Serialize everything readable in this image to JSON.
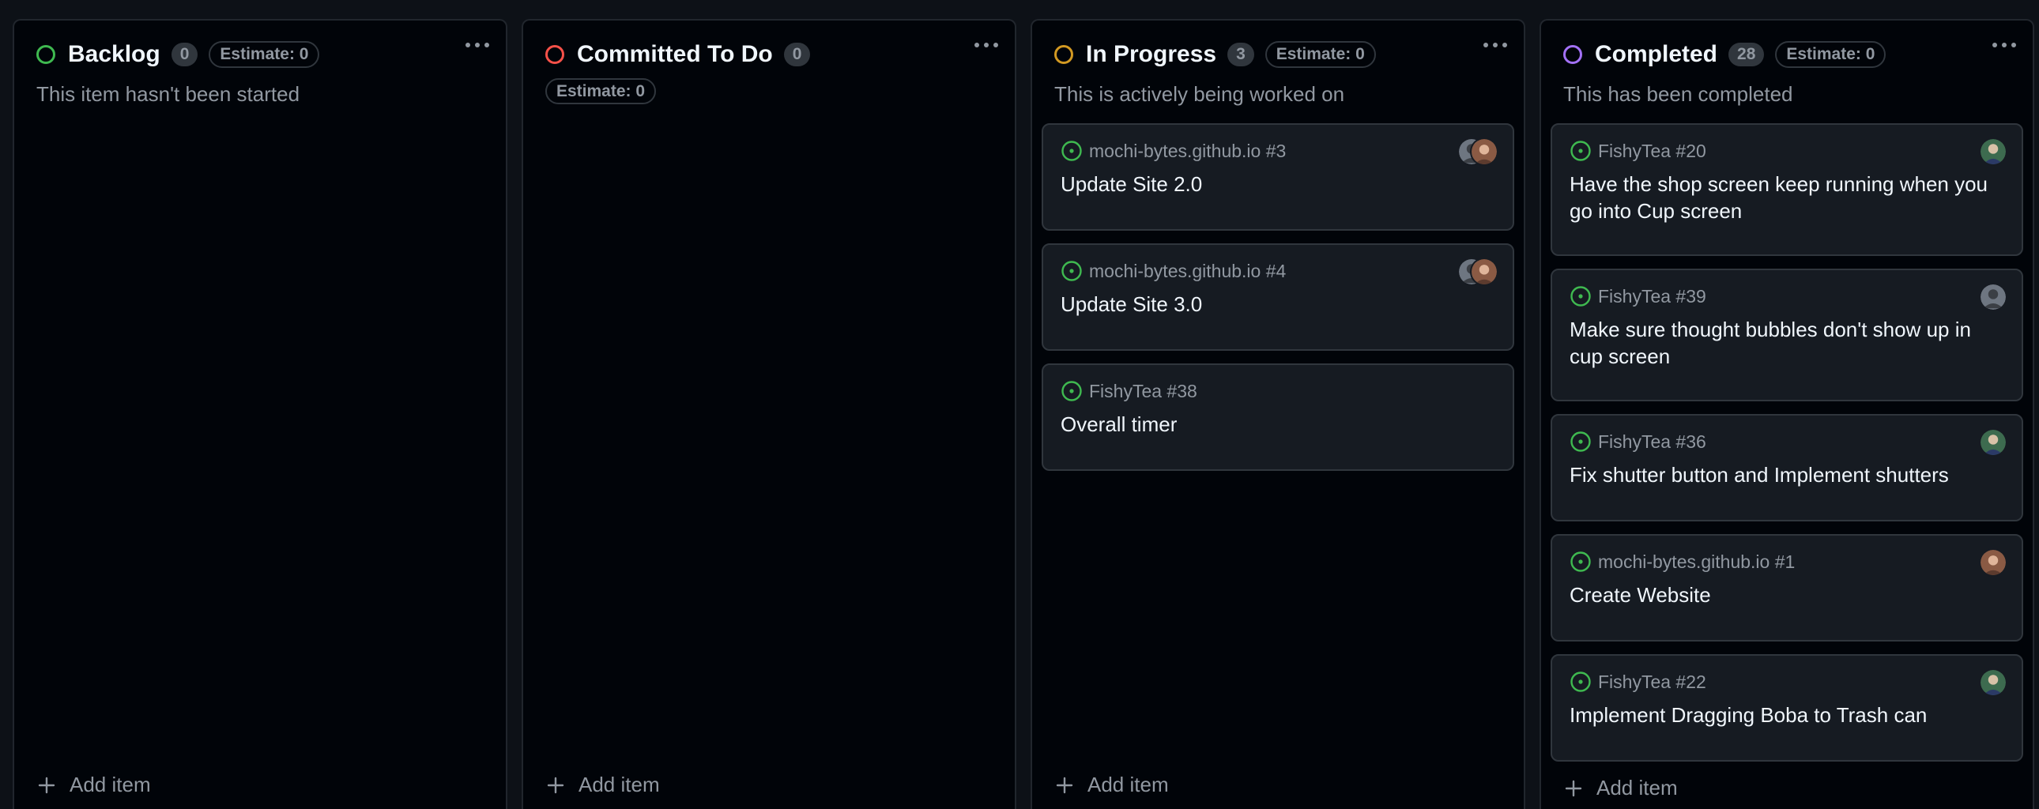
{
  "board": {
    "columns": [
      {
        "title": "Backlog",
        "count": "0",
        "estimate": "Estimate: 0",
        "description": "This item hasn't been started",
        "status_color": "#3fb950",
        "add_label": "Add item",
        "cards": []
      },
      {
        "title": "Committed To Do",
        "count": "0",
        "estimate": "Estimate: 0",
        "description": "",
        "status_color": "#f85149",
        "add_label": "Add item",
        "cards": []
      },
      {
        "title": "In Progress",
        "count": "3",
        "estimate": "Estimate: 0",
        "description": "This is actively being worked on",
        "status_color": "#d29922",
        "add_label": "Add item",
        "cards": [
          {
            "ref": "mochi-bytes.github.io #3",
            "title": "Update Site 2.0",
            "avatars": [
              "dark",
              "brown"
            ]
          },
          {
            "ref": "mochi-bytes.github.io #4",
            "title": "Update Site 3.0",
            "avatars": [
              "dark",
              "brown"
            ]
          },
          {
            "ref": "FishyTea #38",
            "title": "Overall timer",
            "avatars": []
          }
        ]
      },
      {
        "title": "Completed",
        "count": "28",
        "estimate": "Estimate: 0",
        "description": "This has been completed",
        "status_color": "#a371f7",
        "add_label": "Add item",
        "cards": [
          {
            "ref": "FishyTea #20",
            "title": "Have the shop screen keep running when you go into Cup screen",
            "avatars": [
              "green"
            ]
          },
          {
            "ref": "FishyTea #39",
            "title": "Make sure thought bubbles don't show up in cup screen",
            "avatars": [
              "dark"
            ]
          },
          {
            "ref": "FishyTea #36",
            "title": "Fix shutter button and Implement shutters",
            "avatars": [
              "green"
            ]
          },
          {
            "ref": "mochi-bytes.github.io #1",
            "title": "Create Website",
            "avatars": [
              "brown"
            ]
          },
          {
            "ref": "FishyTea #22",
            "title": "Implement Dragging Boba to Trash can",
            "avatars": [
              "green"
            ]
          }
        ]
      }
    ]
  },
  "colors": {
    "background": "#0d1117",
    "column_bg": "#010409",
    "card_bg": "#161b22",
    "border": "#30363d",
    "muted_text": "#9198a1",
    "issue_open": "#3fb950"
  },
  "icons": {
    "issue": "issue-opened-icon",
    "menu": "kebab-horizontal-icon",
    "add": "plus-icon",
    "avatar": "user-avatar"
  }
}
